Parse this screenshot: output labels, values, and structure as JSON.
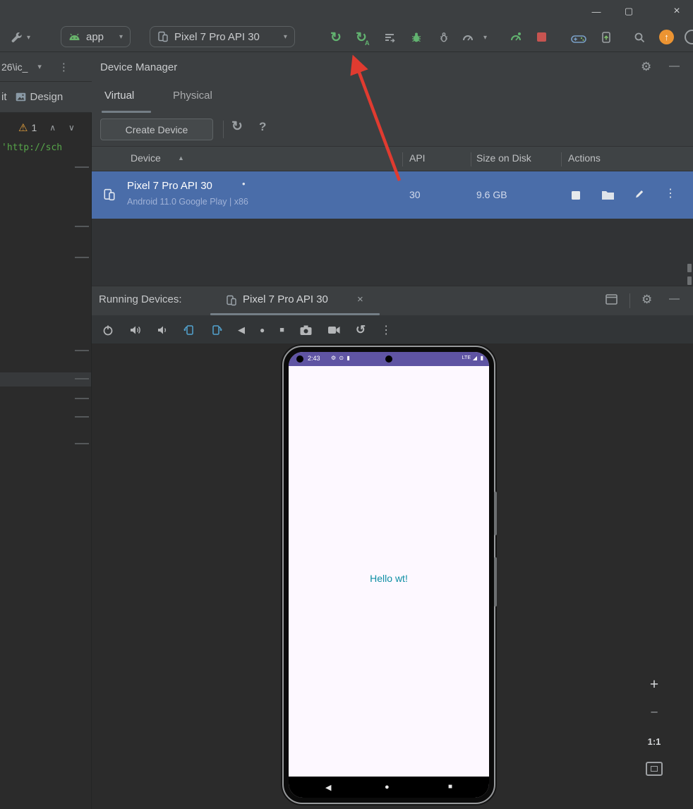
{
  "titlebar": {
    "minimize_icon": "—",
    "maximize_icon": "▢",
    "close_icon": "×"
  },
  "toolbar": {
    "run_config_label": "app",
    "device_label": "Pixel 7 Pro API 30",
    "apply_code_badge": "A"
  },
  "left_panel": {
    "breadcrumb": "26\\ic_",
    "tab_partial": "it",
    "design_tab": "Design",
    "warning_count": "1",
    "code_snippet": "'http://sch"
  },
  "device_manager": {
    "title": "Device Manager",
    "tab_virtual": "Virtual",
    "tab_physical": "Physical",
    "create_device": "Create Device",
    "columns": {
      "device": "Device",
      "api": "API",
      "size": "Size on Disk",
      "actions": "Actions"
    },
    "row": {
      "name": "Pixel 7 Pro API 30",
      "running_dot": "•",
      "subtitle": "Android 11.0 Google Play | x86",
      "api": "30",
      "size": "9.6 GB"
    }
  },
  "running_devices": {
    "label": "Running Devices:",
    "tab_label": "Pixel 7 Pro API 30"
  },
  "phone": {
    "time": "2:43",
    "status_icons": "⚙ ⊙ ▮",
    "carrier": "LTE",
    "signal_icon": "◢",
    "battery_icon": "▮",
    "message": "Hello wt!"
  },
  "zoom": {
    "ratio": "1:1"
  },
  "colors": {
    "selection_blue": "#4a6da9",
    "status_purple": "#5f54a3",
    "hello_teal": "#0e8fa5",
    "arrow_red": "#e03b30",
    "stop_red": "#c75450",
    "update_orange": "#ec9432",
    "android_green": "#68b36b"
  },
  "icons": {
    "chevron_down": "▾",
    "kebab": "⋮",
    "gear": "⚙",
    "panel_minimize": "—",
    "sort_asc": "▲",
    "warning": "⚠",
    "chevron_up_sm": "∧",
    "chevron_down_sm": "∨",
    "refresh": "↻",
    "help": "?",
    "close": "×",
    "back": "◀",
    "home": "●",
    "overview": "■",
    "snapshot": "↺",
    "plus": "+",
    "minus": "−",
    "up_arrow": "↑"
  }
}
